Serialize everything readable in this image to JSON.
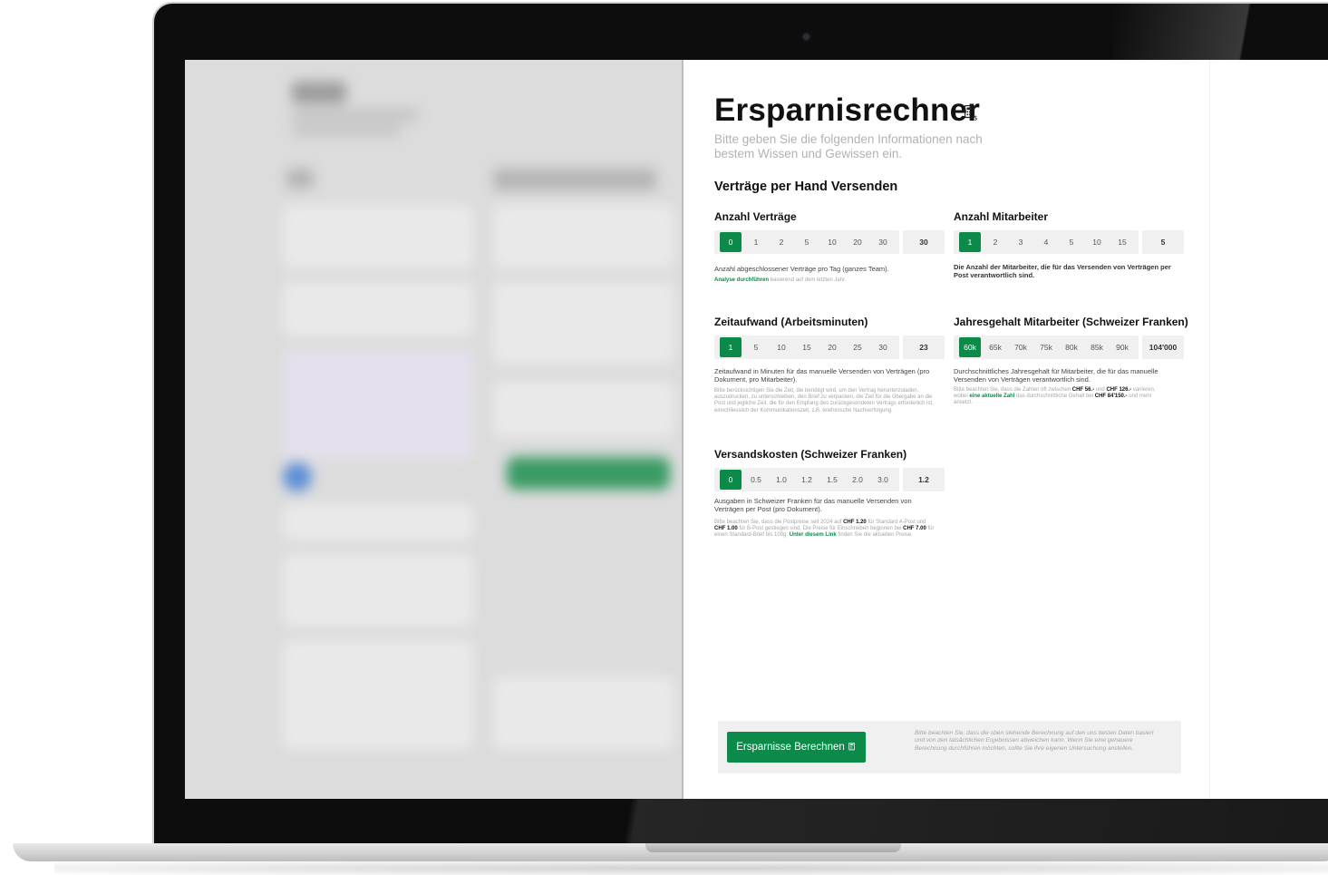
{
  "calculator": {
    "title": "Ersparnisrechner",
    "subtitle": "Bitte geben Sie die folgenden Informationen nach bestem Wissen und Gewissen ein.",
    "section_title": "Verträge per Hand Versenden"
  },
  "contracts": {
    "label": "Anzahl Verträge",
    "options": [
      "0",
      "1",
      "2",
      "5",
      "10",
      "20",
      "30"
    ],
    "selected": "0",
    "value": "30",
    "description": "Anzahl abgeschlossener Verträge pro Tag (ganzes Team).",
    "analysis_link": "Analyse durchführen",
    "analysis_note": " basierend auf dem letzten Jahr."
  },
  "employees": {
    "label": "Anzahl Mitarbeiter",
    "options": [
      "1",
      "2",
      "3",
      "4",
      "5",
      "10",
      "15"
    ],
    "selected": "1",
    "value": "5",
    "description": "Die Anzahl der Mitarbeiter, die für das Versenden von Verträgen per Post verantwortlich sind."
  },
  "time": {
    "label": "Zeitaufwand (Arbeitsminuten)",
    "options": [
      "1",
      "5",
      "10",
      "15",
      "20",
      "25",
      "30"
    ],
    "selected": "1",
    "value": "23",
    "description": "Zeitaufwand in Minuten für das manuelle Versenden von Verträgen (pro Dokument, pro Mitarbeiter).",
    "note": "Bitte berücksichtigen Sie die Zeit, die benötigt wird, um den Vertrag herunterzuladen, auszudrucken, zu unterschreiben, den Brief zu verpacken, die Zeit für die Übergabe an die Post und jegliche Zeit, die für den Empfang des zurückgesendeten Vertrags erforderlich ist, einschliesslich der Kommunikationszeit, z.B. telefonische Nachverfolgung."
  },
  "salary": {
    "label": "Jahresgehalt Mitarbeiter (Schweizer Franken)",
    "options": [
      "60k",
      "65k",
      "70k",
      "75k",
      "80k",
      "85k",
      "90k"
    ],
    "selected": "60k",
    "value": "104'000",
    "description": "Durchschnittliches Jahresgehalt für Mitarbeiter, die für das manuelle Versenden von Verträgen verantwortlich sind.",
    "note_a": "Bitte beachten Sie, dass die Zahlen oft zwischen ",
    "note_b": "CHF 56.-",
    "note_c": " und ",
    "note_d": "CHF 126.-",
    "note_e": " variieren, wobei ",
    "note_f": "eine aktuelle Zahl",
    "note_g": " das durchschnittliche Gehalt bei ",
    "note_h": "CHF 84'150.-",
    "note_i": " und mehr ansetzt."
  },
  "shipping": {
    "label": "Versandskosten (Schweizer Franken)",
    "options": [
      "0",
      "0.5",
      "1.0",
      "1.2",
      "1.5",
      "2.0",
      "3.0"
    ],
    "selected": "0",
    "value": "1.2",
    "description": "Ausgaben in Schweizer Franken für das manuelle Versenden von Verträgen per Post (pro Dokument).",
    "note_a": "Bitte beachten Sie, dass die Postpreise seit 2024 auf ",
    "note_b": "CHF 1.20",
    "note_c": " für Standard A-Post und ",
    "note_d": "CHF 1.00",
    "note_e": " für B-Post gestiegen sind. Die Preise für Einschreiben beginnen bei ",
    "note_f": "CHF 7.00",
    "note_g": " für einen Standard-Brief bis 100g. ",
    "note_link": "Unter diesem Link",
    "note_h": " finden Sie die aktuellen Preise."
  },
  "footer": {
    "button_label": "Ersparnisse Berechnen",
    "disclaimer": "Bitte beachten Sie, dass die oben stehende Berechnung auf den uns besten Daten basiert und von den tatsächlichen Ergebnissen abweichen kann. Wenn Sie eine genauere Berechnung durchführen möchten, sollte Sie ihre eigenen Untersuchung anstellen."
  },
  "colors": {
    "accent": "#0b8a4a",
    "muted_text": "#a5a5a5",
    "segment_bg": "#f0f0f0"
  },
  "icons": {
    "calculator": "calculator-dollar-icon"
  }
}
